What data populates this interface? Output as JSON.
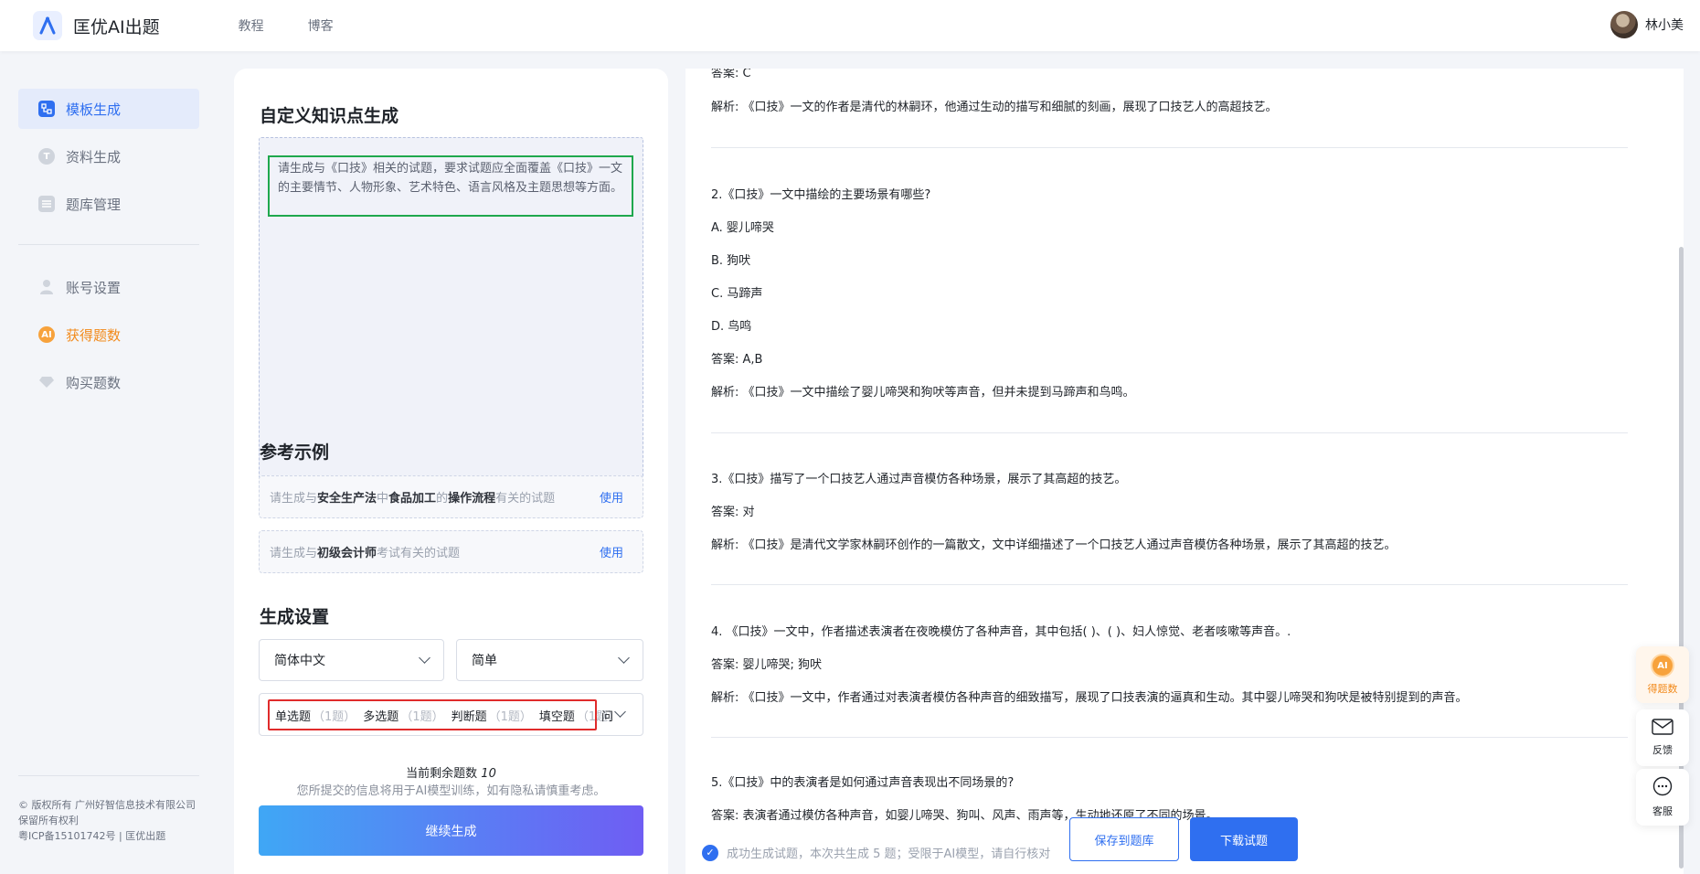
{
  "app": {
    "title": "匡优AI出题"
  },
  "nav": {
    "items": [
      "教程",
      "博客"
    ]
  },
  "user": {
    "name": "林小美"
  },
  "sidebar": {
    "items": [
      {
        "label": "模板生成",
        "icon": "template-icon"
      },
      {
        "label": "资料生成",
        "icon": "document-icon"
      },
      {
        "label": "题库管理",
        "icon": "database-icon"
      },
      {
        "label": "账号设置",
        "icon": "user-icon"
      },
      {
        "label": "获得题数",
        "icon": "ai-badge-icon"
      },
      {
        "label": "购买题数",
        "icon": "diamond-icon"
      }
    ],
    "footer": {
      "copyright": "© 版权所有 广州好智信息技术有限公司",
      "rights": "保留所有权利",
      "icp": "粤ICP备15101742号 | 匡优出题"
    }
  },
  "custom": {
    "title": "自定义知识点生成",
    "prompt": "请生成与《口技》相关的试题，要求试题应全面覆盖《口技》一文的主要情节、人物形象、艺术特色、语言风格及主题思想等方面。"
  },
  "examples": {
    "title": "参考示例",
    "use_label": "使用",
    "ex1": {
      "p1": "请生成与",
      "k1": "安全生产法",
      "p2": "中",
      "k2": "食品加工",
      "p3": "的",
      "k3": "操作流程",
      "p4": "有关的试题"
    },
    "ex2": {
      "p1": "请生成与",
      "k1": "初级会计师",
      "p2": "考试有关的试题"
    }
  },
  "settings": {
    "title": "生成设置",
    "language": "简体中文",
    "difficulty": "简单",
    "types": [
      {
        "name": "单选题",
        "count": "（1题）"
      },
      {
        "name": "多选题",
        "count": "（1题）"
      },
      {
        "name": "判断题",
        "count": "（1题）"
      },
      {
        "name": "填空题",
        "count": "（1题）"
      }
    ],
    "types_more": "问",
    "remaining_label": "当前剩余题数",
    "remaining_value": "10",
    "privacy": "您所提交的信息将用于AI模型训练，如有隐私请慎重考虑。",
    "generate_button": "继续生成"
  },
  "questions": {
    "q1_answer": "答案: C",
    "q1_analysis": "解析: 《口技》一文的作者是清代的林嗣环，他通过生动的描写和细腻的刻画，展现了口技艺人的高超技艺。",
    "q2_stem": "2.《口技》一文中描绘的主要场景有哪些?",
    "q2_a": "A. 婴儿啼哭",
    "q2_b": "B. 狗吠",
    "q2_c": "C. 马蹄声",
    "q2_d": "D. 鸟鸣",
    "q2_answer": "答案: A,B",
    "q2_analysis": "解析: 《口技》一文中描绘了婴儿啼哭和狗吠等声音，但并未提到马蹄声和鸟鸣。",
    "q3_stem": "3.《口技》描写了一个口技艺人通过声音模仿各种场景，展示了其高超的技艺。",
    "q3_answer": "答案: 对",
    "q3_analysis": "解析: 《口技》是清代文学家林嗣环创作的一篇散文，文中详细描述了一个口技艺人通过声音模仿各种场景，展示了其高超的技艺。",
    "q4_stem": "4. 《口技》一文中，作者描述表演者在夜晚模仿了各种声音，其中包括( )、( )、妇人惊觉、老者咳嗽等声音。.",
    "q4_answer": "答案: 婴儿啼哭; 狗吠",
    "q4_analysis": "解析: 《口技》一文中，作者通过对表演者模仿各种声音的细致描写，展现了口技表演的逼真和生动。其中婴儿啼哭和狗吠是被特别提到的声音。",
    "q5_stem": "5.《口技》中的表演者是如何通过声音表现出不同场景的?",
    "q5_answer": "答案: 表演者通过模仿各种声音，如婴儿啼哭、狗叫、风声、雨声等，生动地还原了不同的场景。"
  },
  "status": {
    "text": "成功生成试题，本次共生成 5 题；受限于AI模型，请自行核对"
  },
  "actions": {
    "save": "保存到题库",
    "download": "下载试题"
  },
  "floating": {
    "ai": "得题数",
    "ai_badge": "AI",
    "feedback": "反馈",
    "service": "客服"
  },
  "colors": {
    "primary": "#2f6ff0",
    "orange": "#f28a1b",
    "green_highlight": "#1fa84d",
    "red_highlight": "#e02b2b"
  }
}
